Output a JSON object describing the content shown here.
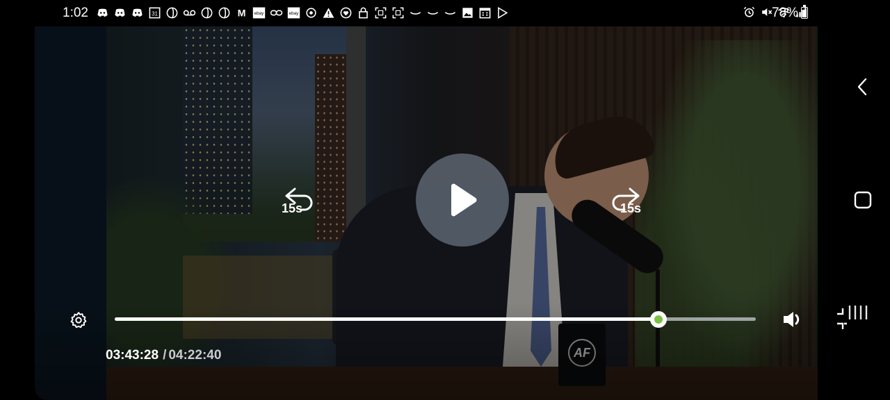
{
  "status_bar": {
    "time": "1:02",
    "battery": "78%",
    "notification_icons": [
      "discord-icon",
      "discord-icon",
      "discord-icon",
      "calendar-icon",
      "threads-icon",
      "voicemail-icon",
      "threads-icon",
      "threads-icon",
      "gmail-icon",
      "ebay-icon",
      "link-icon",
      "ebay-icon",
      "target-icon",
      "warning-icon",
      "heart-shield-icon",
      "lock-icon",
      "scan-icon",
      "scan-icon",
      "amazon-icon",
      "amazon-icon",
      "amazon-icon",
      "gallery-icon",
      "calendar-grid-icon",
      "play-store-icon"
    ],
    "calendar_day": "31",
    "ebay_text": "ebay",
    "gmail_text": "M",
    "system_icons": [
      "alarm-icon",
      "mute-icon",
      "wifi-icon",
      "signal-icon"
    ]
  },
  "player": {
    "rewind_label": "15s",
    "forward_label": "15s",
    "current_time": "03:43:28",
    "separator": "/",
    "total_time": "04:22:40",
    "progress_fraction": 0.848,
    "mug_logo": "AF",
    "accent_color": "#7cc043"
  }
}
